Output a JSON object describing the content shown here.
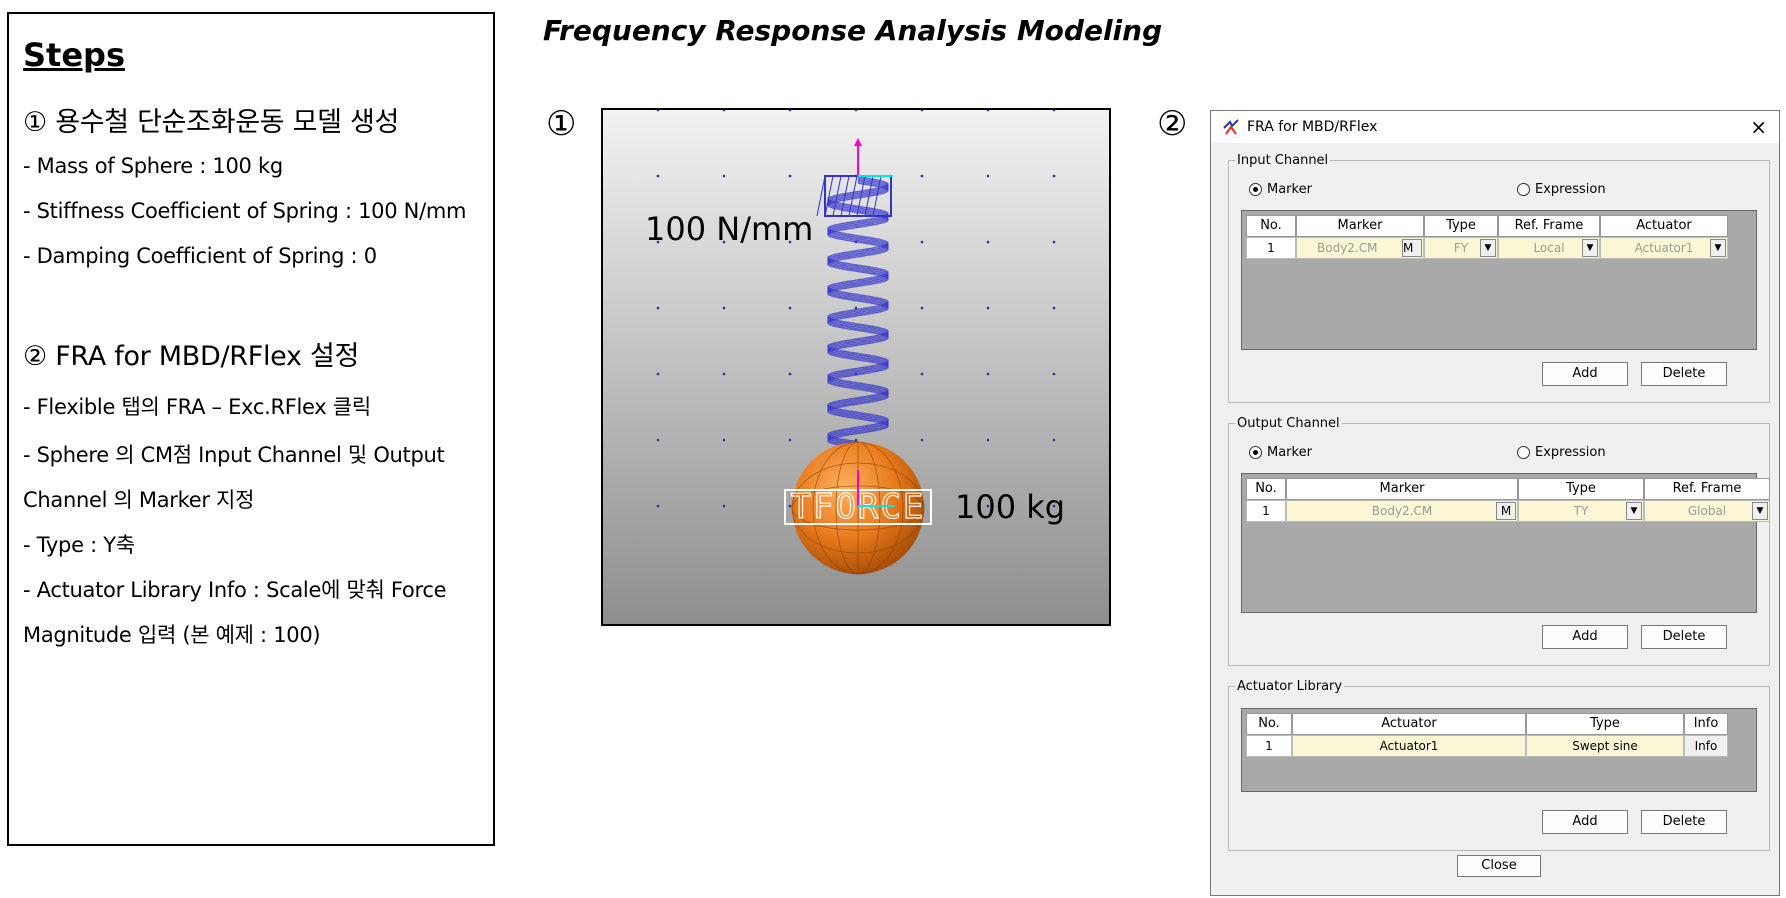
{
  "page_title": "Frequency Response Analysis Modeling",
  "markers": {
    "one": "①",
    "two": "②"
  },
  "steps": {
    "title": "Steps",
    "step1": "① 용수철 단순조화운동 모델 생성",
    "mass": "- Mass of Sphere : 100 kg",
    "stiffness": "- Stiffness Coefficient of Spring : 100 N/mm",
    "damping": "- Damping Coefficient of Spring : 0",
    "step2": "② FRA for MBD/RFlex 설정",
    "flexible": "- Flexible 탭의 FRA – Exc.RFlex 클릭",
    "sphere_a": "- Sphere 의 CM점 Input Channel 및 Output",
    "sphere_b": "Channel 의 Marker 지정",
    "type": "- Type : Y축",
    "actuator_a": "- Actuator Library Info : Scale에 맞춰 Force",
    "actuator_b": "Magnitude 입력 (본 예제 : 100)"
  },
  "viewport": {
    "spring_label": "100 N/mm",
    "mass_label": "100 kg",
    "force_label": "TFORCE",
    "colors": {
      "spring": "#3333cc",
      "sphere": "#e87a1c",
      "axis_magenta": "#ff00cc",
      "axis_cyan": "#00e5e5"
    }
  },
  "dialog": {
    "title": "FRA for MBD/RFlex",
    "close_x": "×",
    "input": {
      "legend": "Input Channel",
      "radio_marker": "Marker",
      "radio_expression": "Expression",
      "headers": [
        "No.",
        "Marker",
        "Type",
        "Ref. Frame",
        "Actuator"
      ],
      "row": {
        "no": "1",
        "marker": "Body2.CM",
        "m": "M",
        "type": "FY",
        "ref": "Local",
        "actuator": "Actuator1"
      },
      "add": "Add",
      "delete": "Delete"
    },
    "output": {
      "legend": "Output Channel",
      "radio_marker": "Marker",
      "radio_expression": "Expression",
      "headers": [
        "No.",
        "Marker",
        "Type",
        "Ref. Frame"
      ],
      "row": {
        "no": "1",
        "marker": "Body2.CM",
        "m": "M",
        "type": "TY",
        "ref": "Global"
      },
      "add": "Add",
      "delete": "Delete"
    },
    "library": {
      "legend": "Actuator Library",
      "headers": [
        "No.",
        "Actuator",
        "Type",
        "Info"
      ],
      "row": {
        "no": "1",
        "actuator": "Actuator1",
        "type": "Swept sine",
        "info": "Info"
      },
      "add": "Add",
      "delete": "Delete"
    },
    "close": "Close"
  }
}
